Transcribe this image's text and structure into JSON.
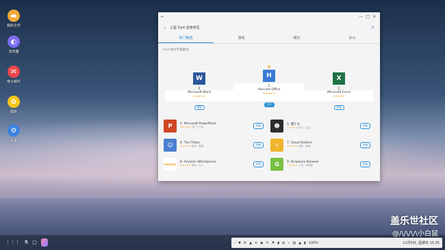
{
  "desktop": {
    "icons": [
      {
        "label": "我的文件",
        "color": "#f0a93a",
        "glyph": "▬",
        "icon": "folder-icon"
      },
      {
        "label": "浏览器",
        "color": "#7b6cf0",
        "glyph": "◐",
        "icon": "browser-icon"
      },
      {
        "label": "电子邮件",
        "color": "#e8474a",
        "glyph": "✉",
        "icon": "mail-icon"
      },
      {
        "label": "图库",
        "color": "#f5c51a",
        "glyph": "✿",
        "icon": "gallery-icon"
      },
      {
        "label": "设置",
        "color": "#3b82e0",
        "glyph": "⚙",
        "icon": "gear-icon"
      }
    ]
  },
  "window": {
    "titlebar": {
      "back": "←",
      "minimize": "—",
      "maximize": "□",
      "close": "✕"
    },
    "header": {
      "back": "‹",
      "title": "三星 DeX 应用专区",
      "search": "⌕"
    },
    "tabs": [
      {
        "label": "热门精选",
        "active": true
      },
      {
        "label": "游戏",
        "active": false
      },
      {
        "label": "娱乐",
        "active": false
      },
      {
        "label": "办公",
        "active": false
      }
    ],
    "subtitle": "DeX 模式专属推荐"
  },
  "podium": [
    {
      "rank": "2",
      "name": "Microsoft Word",
      "stars": "★★★★★",
      "btn": "更新",
      "color": "#2b579a",
      "letter": "W",
      "filled": false
    },
    {
      "rank": "1",
      "name": "Hancom Office",
      "stars": "★★★★★",
      "btn": "打开",
      "color": "#3a7bd5",
      "letter": "H",
      "filled": true
    },
    {
      "rank": "2",
      "name": "Microsoft Excel",
      "stars": "★★★★★",
      "btn": "安装",
      "color": "#1f7244",
      "letter": "X",
      "filled": false
    }
  ],
  "list": [
    [
      {
        "num": "4.",
        "name": "Microsoft PowerPoint",
        "stars": "★★★★★",
        "meta": "生产力工具",
        "btn": "安装",
        "color": "#d24726",
        "glyph": "P"
      },
      {
        "num": "5.",
        "name": "饿了么",
        "stars": "★★★★★",
        "meta": "社交 · 生活",
        "btn": "安装",
        "color": "#2d2d2d",
        "glyph": "☻"
      }
    ],
    [
      {
        "num": "6.",
        "name": "The Tribez",
        "stars": "★★★★★",
        "meta": "游戏 · 策略",
        "btn": "安装",
        "color": "#4b7fcf",
        "glyph": "☺"
      },
      {
        "num": "7.",
        "name": "Cloud Raiders",
        "stars": "★★★★★",
        "meta": "游戏 · 策略",
        "btn": "安装",
        "color": "#f0b429",
        "glyph": "☼"
      }
    ],
    [
      {
        "num": "8.",
        "name": "Amazon WorkSpaces",
        "stars": "★★★★★",
        "meta": "商务 · 办公",
        "btn": "安装",
        "color": "#ffffff",
        "glyph": "amazon"
      },
      {
        "num": "9.",
        "name": "Dropzone Browser",
        "stars": "★★★★★",
        "meta": "工具 · 浏览器",
        "btn": "安装",
        "color": "#7ac143",
        "glyph": "G"
      }
    ]
  ],
  "taskbar": {
    "left": [
      "⋮⋮⋮",
      "⚗",
      "▢"
    ],
    "tray": [
      "›",
      "▼",
      "✉",
      "▲",
      "✦",
      "◉",
      "✎",
      "⚑",
      "▮",
      "◍",
      "⌁",
      "▨",
      "▲",
      "▮"
    ],
    "battery": "100%",
    "clock": "11月5日, 星期日  15:25"
  },
  "watermark": {
    "line1": "盖乐世社区",
    "line2": "@/\\/\\/\\/\\小白鼠"
  }
}
